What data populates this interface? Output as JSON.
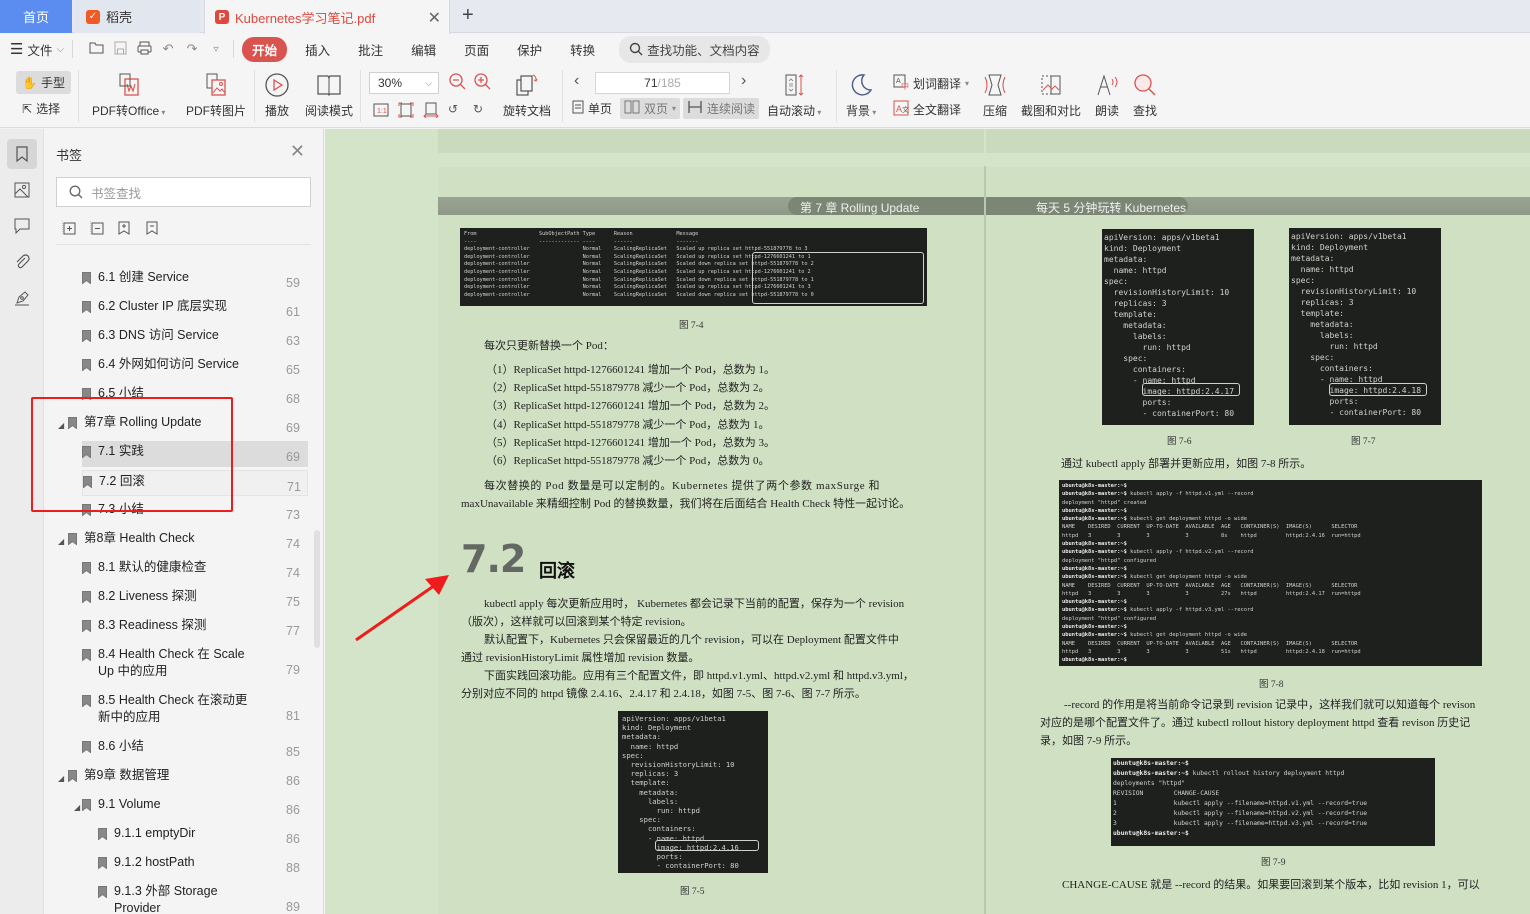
{
  "tabs": {
    "home": "首页",
    "daoke": "稻壳",
    "document": "Kubernetes学习笔记.pdf",
    "new_tab_icon": "plus-icon",
    "close_icon": "close-icon"
  },
  "menu": {
    "file": "文件",
    "tabs": [
      "开始",
      "插入",
      "批注",
      "编辑",
      "页面",
      "保护",
      "转换"
    ],
    "active_tab": "开始",
    "search_placeholder": "查找功能、文档内容",
    "accent_color": "#d9534f"
  },
  "ribbon": {
    "hand_tool": "手型",
    "select_tool": "选择",
    "pdf_to_office": "PDF转Office",
    "pdf_to_image": "PDF转图片",
    "play": "播放",
    "read_mode": "阅读模式",
    "zoom_level": "30%",
    "rotate_doc": "旋转文档",
    "current_page": "71",
    "total_pages": "/185",
    "single_page": "单页",
    "double_page": "双页",
    "continuous": "连续阅读",
    "auto_scroll": "自动滚动",
    "background": "背景",
    "word_translate": "划词翻译",
    "full_translate": "全文翻译",
    "compress": "压缩",
    "screenshot_compare": "截图和对比",
    "read_aloud": "朗读",
    "find": "查找"
  },
  "bookmarks": {
    "title": "书签",
    "search_placeholder": "书签查找",
    "items": [
      {
        "label": "6.1 创建 Service",
        "page": "59",
        "level": 2
      },
      {
        "label": "6.2 Cluster IP 底层实现",
        "page": "61",
        "level": 2
      },
      {
        "label": "6.3 DNS 访问 Service",
        "page": "63",
        "level": 2
      },
      {
        "label": "6.4 外网如何访问 Service",
        "page": "65",
        "level": 2
      },
      {
        "label": "6.5 小结",
        "page": "68",
        "level": 2
      },
      {
        "label": "第7章 Rolling Update",
        "page": "69",
        "level": 1,
        "expanded": true
      },
      {
        "label": "7.1 实践",
        "page": "69",
        "level": 2,
        "selected": true
      },
      {
        "label": "7.2 回滚",
        "page": "71",
        "level": 2
      },
      {
        "label": "7.3 小结",
        "page": "73",
        "level": 2
      },
      {
        "label": "第8章 Health Check",
        "page": "74",
        "level": 1,
        "expanded": true
      },
      {
        "label": "8.1 默认的健康检查",
        "page": "74",
        "level": 2
      },
      {
        "label": "8.2 Liveness 探测",
        "page": "75",
        "level": 2
      },
      {
        "label": "8.3 Readiness 探测",
        "page": "77",
        "level": 2
      },
      {
        "label": "8.4 Health Check 在 Scale Up 中的应用",
        "page": "79",
        "level": 2
      },
      {
        "label": "8.5 Health Check 在滚动更新中的应用",
        "page": "81",
        "level": 2
      },
      {
        "label": "8.6 小结",
        "page": "85",
        "level": 2
      },
      {
        "label": "第9章 数据管理",
        "page": "86",
        "level": 1,
        "expanded": true
      },
      {
        "label": "9.1 Volume",
        "page": "86",
        "level": 2,
        "expanded": true
      },
      {
        "label": "9.1.1 emptyDir",
        "page": "86",
        "level": 3
      },
      {
        "label": "9.1.2 hostPath",
        "page": "88",
        "level": 3
      },
      {
        "label": "9.1.3 外部 Storage Provider",
        "page": "89",
        "level": 3
      }
    ]
  },
  "left_page": {
    "header": "第 7 章   Rolling Update",
    "fig74": {
      "headers": [
        "From",
        "SubObjectPath",
        "Type",
        "Reason",
        "Message"
      ],
      "rows": [
        [
          "deployment-controller",
          "",
          "Normal",
          "ScalingReplicaSet",
          "Scaled up replica set httpd-551879778 to 3"
        ],
        [
          "deployment-controller",
          "",
          "Normal",
          "ScalingReplicaSet",
          "Scaled up replica set httpd-1276601241 to 1"
        ],
        [
          "deployment-controller",
          "",
          "Normal",
          "ScalingReplicaSet",
          "Scaled down replica set httpd-551879778 to 2"
        ],
        [
          "deployment-controller",
          "",
          "Normal",
          "ScalingReplicaSet",
          "Scaled up replica set httpd-1276601241 to 2"
        ],
        [
          "deployment-controller",
          "",
          "Normal",
          "ScalingReplicaSet",
          "Scaled down replica set httpd-551879778 to 1"
        ],
        [
          "deployment-controller",
          "",
          "Normal",
          "ScalingReplicaSet",
          "Scaled up replica set httpd-1276601241 to 3"
        ],
        [
          "deployment-controller",
          "",
          "Normal",
          "ScalingReplicaSet",
          "Scaled down replica set httpd-551879778 to 0"
        ]
      ],
      "caption": "图 7-4"
    },
    "intro": "每次只更新替换一个 Pod：",
    "steps": [
      "（1）ReplicaSet httpd-1276601241 增加一个 Pod，总数为 1。",
      "（2）ReplicaSet httpd-551879778 减少一个 Pod，总数为 2。",
      "（3）ReplicaSet httpd-1276601241 增加一个 Pod，总数为 2。",
      "（4）ReplicaSet httpd-551879778 减少一个 Pod，总数为 1。",
      "（5）ReplicaSet httpd-1276601241 增加一个 Pod，总数为 3。",
      "（6）ReplicaSet httpd-551879778 减少一个 Pod，总数为 0。"
    ],
    "para1a": "每次替换的 Pod 数量是可以定制的。Kubernetes 提供了两个参数 maxSurge 和",
    "para1b": "maxUnavailable 来精细控制 Pod 的替换数量，我们将在后面结合 Health Check 特性一起讨论。",
    "section_number": "7.2",
    "section_title": "回滚",
    "para2a": "kubectl apply 每次更新应用时， Kubernetes 都会记录下当前的配置，保存为一个 revision",
    "para2b": "（版次），这样就可以回滚到某个特定 revision。",
    "para3a": "默认配置下，Kubernetes 只会保留最近的几个 revision，可以在 Deployment 配置文件中",
    "para3b": "通过 revisionHistoryLimit 属性增加 revision 数量。",
    "para4a": "下面实践回滚功能。应用有三个配置文件，即 httpd.v1.yml、httpd.v2.yml 和 httpd.v3.yml，",
    "para4b": "分别对应不同的 httpd 镜像 2.4.16、2.4.17 和 2.4.18，如图 7-5、图 7-6、图 7-7 所示。",
    "fig75": {
      "lines": [
        "apiVersion: apps/v1beta1",
        "kind: Deployment",
        "metadata:",
        "  name: httpd",
        "spec:",
        "  revisionHistoryLimit: 10",
        "  replicas: 3",
        "  template:",
        "    metadata:",
        "      labels:",
        "        run: httpd",
        "    spec:",
        "      containers:",
        "      - name: httpd",
        "        image: httpd:2.4.16",
        "        ports:",
        "        - containerPort: 80"
      ],
      "caption": "图 7-5"
    }
  },
  "right_page": {
    "header": "每天 5 分钟玩转 Kubernetes",
    "fig76": {
      "lines": [
        "apiVersion: apps/v1beta1",
        "kind: Deployment",
        "metadata:",
        "  name: httpd",
        "spec:",
        "  revisionHistoryLimit: 10",
        "  replicas: 3",
        "  template:",
        "    metadata:",
        "      labels:",
        "        run: httpd",
        "    spec:",
        "      containers:",
        "      - name: httpd",
        "        image: httpd:2.4.17",
        "        ports:",
        "        - containerPort: 80"
      ],
      "caption": "图 7-6"
    },
    "fig77": {
      "lines": [
        "apiVersion: apps/v1beta1",
        "kind: Deployment",
        "metadata:",
        "  name: httpd",
        "spec:",
        "  revisionHistoryLimit: 10",
        "  replicas: 3",
        "  template:",
        "    metadata:",
        "      labels:",
        "        run: httpd",
        "    spec:",
        "      containers:",
        "      - name: httpd",
        "        image: httpd:2.4.18",
        "        ports:",
        "        - containerPort: 80"
      ],
      "caption": "图 7-7"
    },
    "apply_text": "通过 kubectl apply 部署并更新应用，如图 7-8 所示。",
    "fig78": {
      "lines": [
        "ubuntu@k8s-master:~$",
        "ubuntu@k8s-master:~$ kubectl apply -f httpd.v1.yml --record",
        "deployment \"httpd\" created",
        "ubuntu@k8s-master:~$",
        "ubuntu@k8s-master:~$ kubectl get deployment httpd -o wide",
        "NAME    DESIRED  CURRENT  UP-TO-DATE  AVAILABLE  AGE   CONTAINER(S)  IMAGE(S)      SELECTOR",
        "httpd   3        3        3           3          8s    httpd         httpd:2.4.16  run=httpd",
        "ubuntu@k8s-master:~$",
        "ubuntu@k8s-master:~$ kubectl apply -f httpd.v2.yml --record",
        "deployment \"httpd\" configured",
        "ubuntu@k8s-master:~$",
        "ubuntu@k8s-master:~$ kubectl get deployment httpd -o wide",
        "NAME    DESIRED  CURRENT  UP-TO-DATE  AVAILABLE  AGE   CONTAINER(S)  IMAGE(S)      SELECTOR",
        "httpd   3        3        3           3          27s   httpd         httpd:2.4.17  run=httpd",
        "ubuntu@k8s-master:~$",
        "ubuntu@k8s-master:~$ kubectl apply -f httpd.v3.yml --record",
        "deployment \"httpd\" configured",
        "ubuntu@k8s-master:~$",
        "ubuntu@k8s-master:~$ kubectl get deployment httpd -o wide",
        "NAME    DESIRED  CURRENT  UP-TO-DATE  AVAILABLE  AGE   CONTAINER(S)  IMAGE(S)      SELECTOR",
        "httpd   3        3        3           3          51s   httpd         httpd:2.4.18  run=httpd",
        "ubuntu@k8s-master:~$"
      ],
      "caption": "图 7-8"
    },
    "record_a": "--record 的作用是将当前命令记录到 revision 记录中，这样我们就可以知道每个 revison",
    "record_b": "对应的是哪个配置文件了。通过 kubectl rollout history deployment httpd 查看 revison 历史记",
    "record_c": "录，如图 7-9 所示。",
    "fig79": {
      "lines": [
        "ubuntu@k8s-master:~$",
        "ubuntu@k8s-master:~$ kubectl rollout history deployment httpd",
        "deployments \"httpd\"",
        "REVISION        CHANGE-CAUSE",
        "1               kubectl apply --filename=httpd.v1.yml --record=true",
        "2               kubectl apply --filename=httpd.v2.yml --record=true",
        "3               kubectl apply --filename=httpd.v3.yml --record=true",
        "",
        "ubuntu@k8s-master:~$"
      ],
      "caption": "图 7-9"
    },
    "last_line": "CHANGE-CAUSE 就是 --record 的结果。如果要回滚到某个版本，比如 revision 1，可以"
  },
  "annotation": {
    "highlight_color": "#ee1c1c",
    "arrow_icon": "red-arrow-icon"
  }
}
